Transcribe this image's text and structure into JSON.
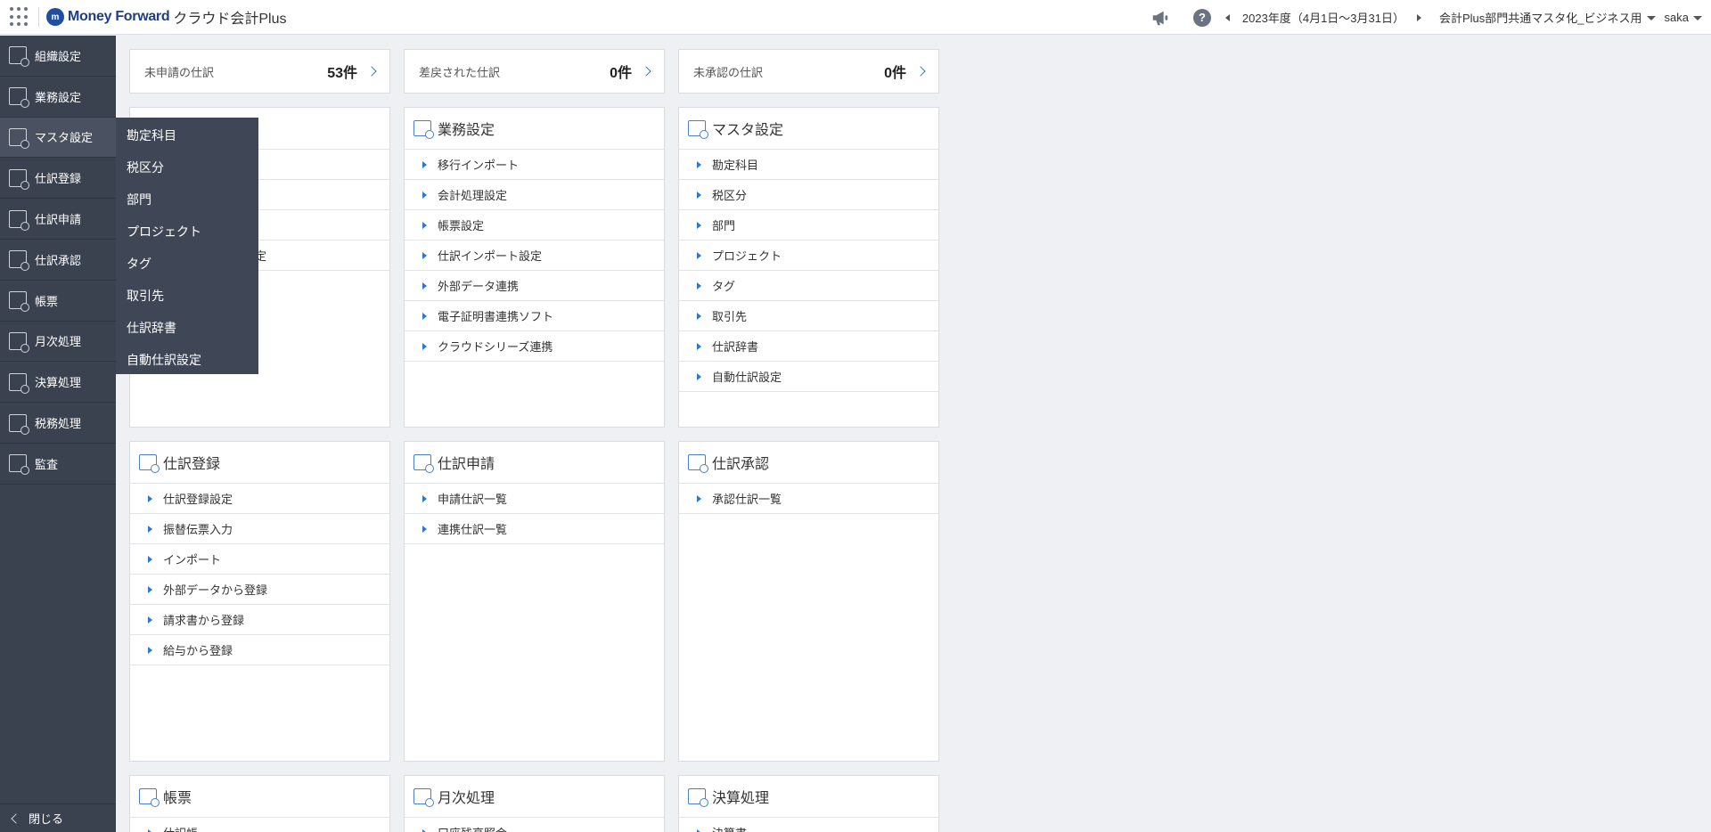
{
  "header": {
    "brand": "Money Forward",
    "product": "クラウド会計Plus",
    "period": "2023年度（4月1日〜3月31日）",
    "office": "会計Plus部門共通マスタ化_ビジネス用",
    "user": "saka"
  },
  "sidebar": {
    "items": [
      {
        "label": "組織設定"
      },
      {
        "label": "業務設定"
      },
      {
        "label": "マスタ設定"
      },
      {
        "label": "仕訳登録"
      },
      {
        "label": "仕訳申請"
      },
      {
        "label": "仕訳承認"
      },
      {
        "label": "帳票"
      },
      {
        "label": "月次処理"
      },
      {
        "label": "決算処理"
      },
      {
        "label": "税務処理"
      },
      {
        "label": "監査"
      }
    ],
    "close_label": "閉じる"
  },
  "flyout": {
    "items": [
      "勘定科目",
      "税区分",
      "部門",
      "プロジェクト",
      "タグ",
      "取引先",
      "仕訳辞書",
      "自動仕訳設定"
    ]
  },
  "summary": [
    {
      "label": "未申請の仕訳",
      "value": "53件"
    },
    {
      "label": "差戻された仕訳",
      "value": "0件"
    },
    {
      "label": "未承認の仕訳",
      "value": "0件"
    }
  ],
  "cards": {
    "c1": {
      "title": "",
      "rows": [
        "",
        "",
        "",
        "定"
      ]
    },
    "gyomu": {
      "title": "業務設定",
      "rows": [
        "移行インポート",
        "会計処理設定",
        "帳票設定",
        "仕訳インポート設定",
        "外部データ連携",
        "電子証明書連携ソフト",
        "クラウドシリーズ連携"
      ]
    },
    "master": {
      "title": "マスタ設定",
      "rows": [
        "勘定科目",
        "税区分",
        "部門",
        "プロジェクト",
        "タグ",
        "取引先",
        "仕訳辞書",
        "自動仕訳設定"
      ]
    },
    "touroku": {
      "title": "仕訳登録",
      "rows": [
        "仕訳登録設定",
        "振替伝票入力",
        "インポート",
        "外部データから登録",
        "請求書から登録",
        "給与から登録"
      ]
    },
    "shinsei": {
      "title": "仕訳申請",
      "rows": [
        "申請仕訳一覧",
        "連携仕訳一覧"
      ]
    },
    "shonin": {
      "title": "仕訳承認",
      "rows": [
        "承認仕訳一覧"
      ]
    },
    "chohyo": {
      "title": "帳票",
      "rows": [
        "仕訳帳"
      ]
    },
    "getsuji": {
      "title": "月次処理",
      "rows": [
        "口座残高照会"
      ]
    },
    "kessan": {
      "title": "決算処理",
      "rows": [
        "決算書"
      ]
    }
  }
}
